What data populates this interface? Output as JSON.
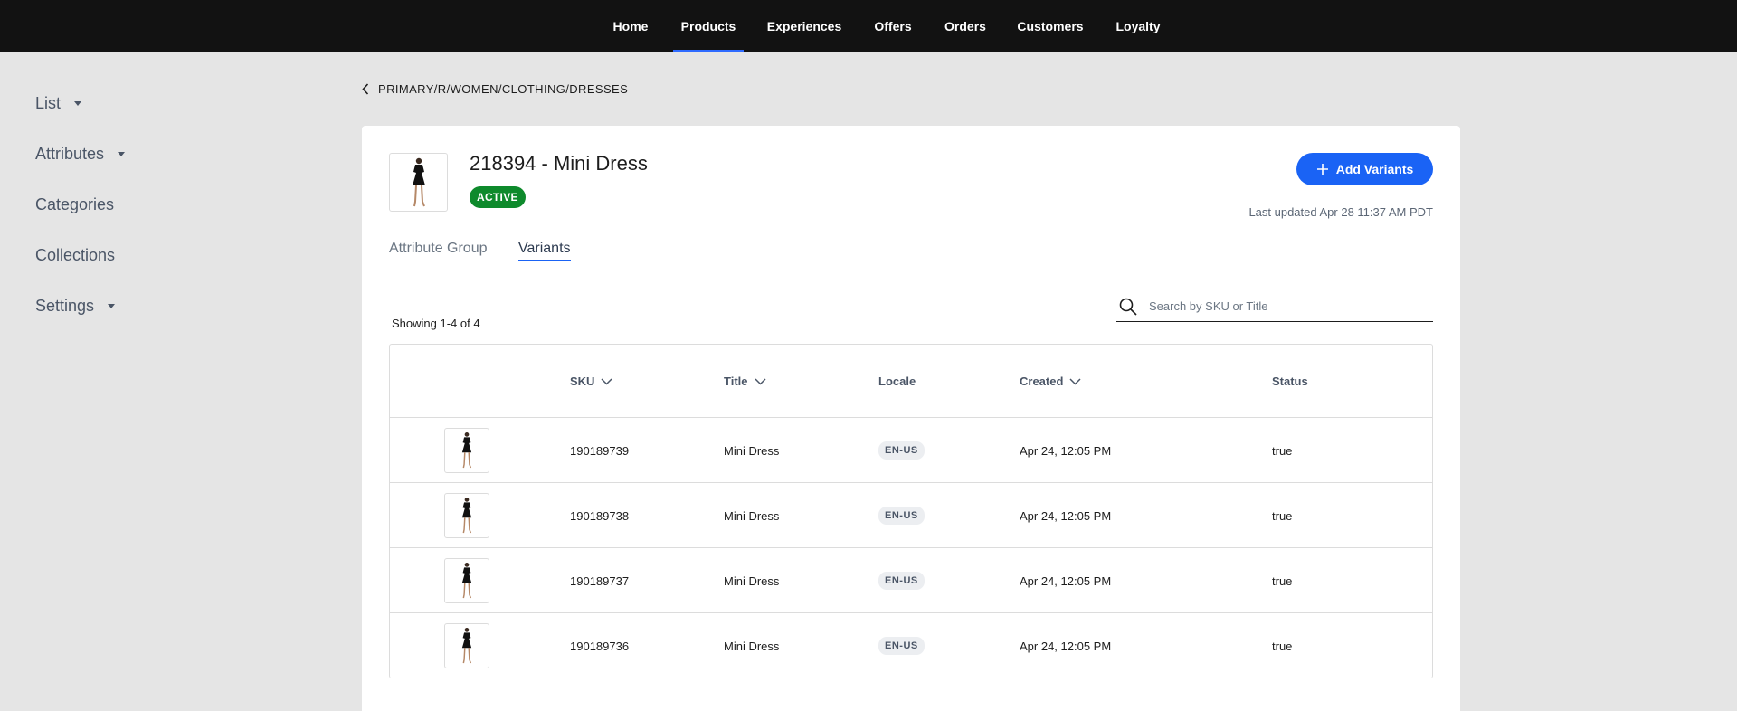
{
  "nav": {
    "items": [
      "Home",
      "Products",
      "Experiences",
      "Offers",
      "Orders",
      "Customers",
      "Loyalty"
    ],
    "active": "Products",
    "accent": "#2f6bff"
  },
  "sidebar": {
    "items": [
      {
        "label": "List",
        "has_dropdown": true
      },
      {
        "label": "Attributes",
        "has_dropdown": true
      },
      {
        "label": "Categories",
        "has_dropdown": false
      },
      {
        "label": "Collections",
        "has_dropdown": false
      },
      {
        "label": "Settings",
        "has_dropdown": true
      }
    ]
  },
  "breadcrumb": {
    "icon": "chevron-left-icon",
    "path": "PRIMARY/R/WOMEN/CLOTHING/DRESSES"
  },
  "product": {
    "title": "218394 - Mini Dress",
    "status": "ACTIVE",
    "status_color": "#0e8a2c",
    "last_updated": "Last updated Apr 28 11:37 AM PDT"
  },
  "actions": {
    "add_variants_label": "Add Variants",
    "button_color": "#1a63f5"
  },
  "tabs": [
    {
      "label": "Attribute Group",
      "selected": false
    },
    {
      "label": "Variants",
      "selected": true
    }
  ],
  "search": {
    "placeholder": "Search by SKU or Title",
    "value": ""
  },
  "showing": "Showing 1-4 of 4",
  "table": {
    "columns": [
      {
        "label": "SKU",
        "sortable": true
      },
      {
        "label": "Title",
        "sortable": true
      },
      {
        "label": "Locale",
        "sortable": false
      },
      {
        "label": "Created",
        "sortable": true
      },
      {
        "label": "Status",
        "sortable": false
      }
    ],
    "rows": [
      {
        "sku": "190189739",
        "title": "Mini Dress",
        "locale": "EN-US",
        "created": "Apr 24, 12:05 PM",
        "status": "true"
      },
      {
        "sku": "190189738",
        "title": "Mini Dress",
        "locale": "EN-US",
        "created": "Apr 24, 12:05 PM",
        "status": "true"
      },
      {
        "sku": "190189737",
        "title": "Mini Dress",
        "locale": "EN-US",
        "created": "Apr 24, 12:05 PM",
        "status": "true"
      },
      {
        "sku": "190189736",
        "title": "Mini Dress",
        "locale": "EN-US",
        "created": "Apr 24, 12:05 PM",
        "status": "true"
      }
    ]
  }
}
